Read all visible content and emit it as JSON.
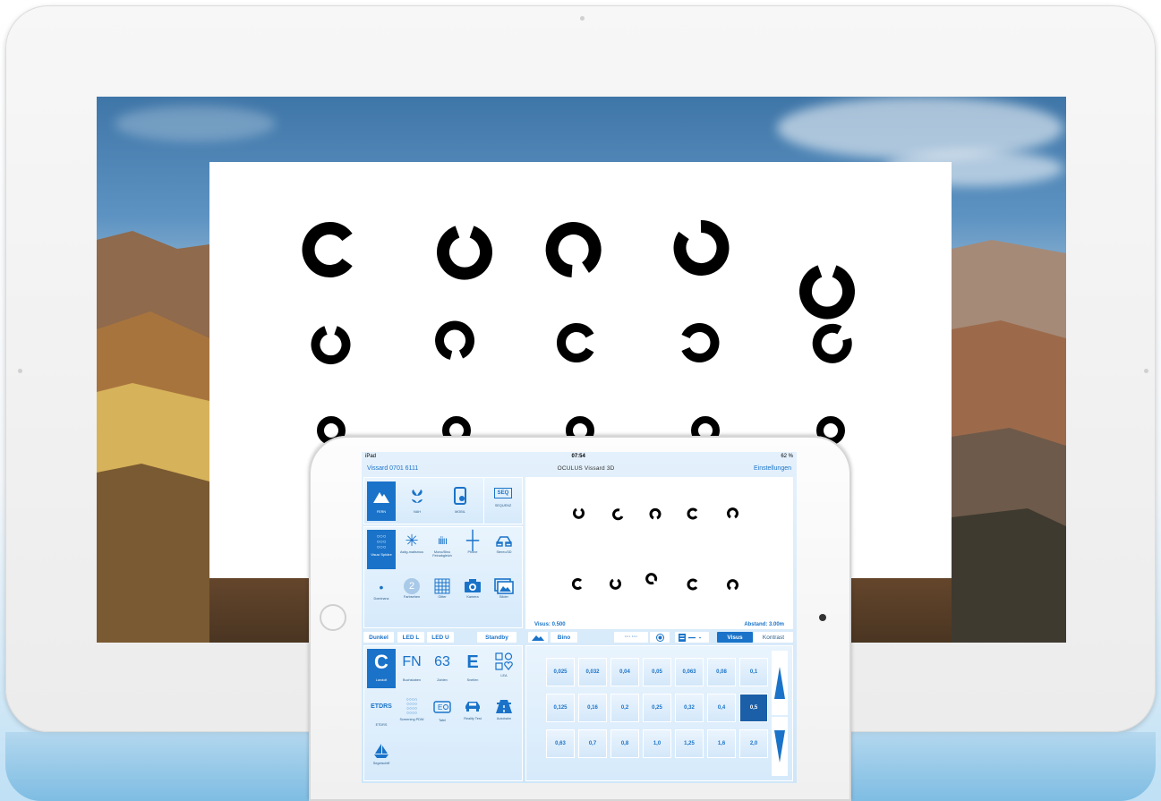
{
  "ipad": {
    "status": {
      "carrier": "iPad",
      "time": "07:54",
      "battery": "62 %"
    },
    "nav": {
      "left": "Vissard 0701 6111",
      "center": "OCULUS Vissard 3D",
      "right": "Einstellungen"
    },
    "modes": [
      {
        "label": "FERN",
        "active": true,
        "icon": "mountain-icon"
      },
      {
        "label": "NAH",
        "active": false,
        "icon": "flower-icon"
      },
      {
        "label": "MOBIL",
        "active": false,
        "icon": "tablet-icon"
      },
      {
        "label": "SEQUENZ",
        "active": false,
        "icon": "seq-icon",
        "badge": "SEQ"
      }
    ],
    "tests": [
      {
        "label": "Visus/ Sphäre",
        "active": true,
        "icon": "landolt-grid-icon"
      },
      {
        "label": "Astig-matismus",
        "active": false,
        "icon": "astigmatism-icon"
      },
      {
        "label": "Mono/Bino Feinabgleich",
        "active": false,
        "icon": "bars-icon"
      },
      {
        "label": "Phorie",
        "active": false,
        "icon": "cross-icon"
      },
      {
        "label": "Stereo/3D",
        "active": false,
        "icon": "glasses-icon"
      },
      {
        "label": "Dominanz",
        "active": false,
        "icon": "dot-icon"
      },
      {
        "label": "Farbsehen",
        "active": false,
        "icon": "color-plate-icon",
        "badge": "2"
      },
      {
        "label": "Gitter",
        "active": false,
        "icon": "grid-icon"
      },
      {
        "label": "Kamera",
        "active": false,
        "icon": "camera-icon"
      },
      {
        "label": "Bilder",
        "active": false,
        "icon": "images-icon"
      }
    ],
    "light_buttons": [
      "Dunkel",
      "LED L",
      "LED U"
    ],
    "standby": "Standby",
    "bino": "Bino",
    "visus_tab": "Visus",
    "kontrast_tab": "Kontrast",
    "optotypes": [
      {
        "label": "Landolt",
        "glyph": "C",
        "active": true
      },
      {
        "label": "Buchstaben",
        "glyph": "FN",
        "active": false
      },
      {
        "label": "Zahlen",
        "glyph": "63",
        "active": false
      },
      {
        "label": "Snellen",
        "glyph": "E",
        "active": false
      },
      {
        "label": "LEA",
        "glyph": "",
        "active": false
      },
      {
        "label": "ETDRS",
        "glyph": "ETDRS",
        "active": false
      },
      {
        "label": "Screening PDW",
        "glyph": "",
        "active": false
      },
      {
        "label": "Tafel",
        "glyph": "",
        "active": false
      },
      {
        "label": "Reality Test",
        "glyph": "",
        "active": false
      },
      {
        "label": "Autobahn",
        "glyph": "",
        "active": false
      },
      {
        "label": "Segelschiff",
        "glyph": "",
        "active": false
      }
    ],
    "visus_values": [
      [
        "0,025",
        "0,032",
        "0,04",
        "0,05",
        "0,063",
        "0,08",
        "0,1"
      ],
      [
        "0,125",
        "0,16",
        "0,2",
        "0,25",
        "0,32",
        "0,4",
        "0,5"
      ],
      [
        "0,63",
        "0,7",
        "0,8",
        "1,0",
        "1,25",
        "1,6",
        "2,0"
      ]
    ],
    "selected_visus": "0,5",
    "preview": {
      "visus": "Visus: 0.500",
      "distance": "Abstand: 3.00m"
    }
  },
  "colors": {
    "accent": "#1a73c9",
    "panel": "#dcecfb"
  }
}
